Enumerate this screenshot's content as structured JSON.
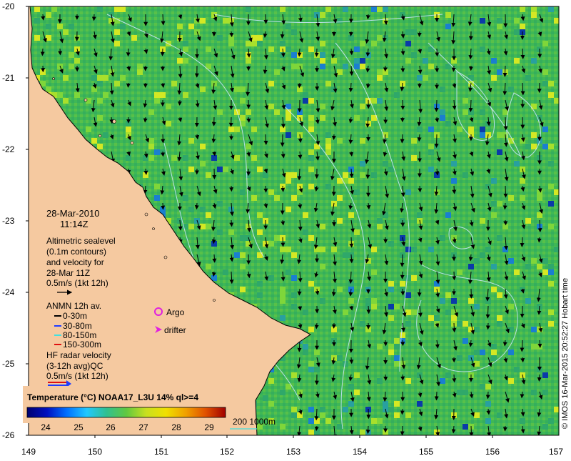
{
  "map": {
    "lat_labels": [
      "-20",
      "-21",
      "-22",
      "-23",
      "-24",
      "-25",
      "-26"
    ],
    "lon_labels": [
      "149",
      "150",
      "151",
      "152",
      "153",
      "154",
      "155",
      "156",
      "157"
    ],
    "colors": {
      "land": "#f5c9a0",
      "ocean_base": "#3fb855",
      "arrow": "#000000",
      "contour": "#cfe9ff",
      "frame": "#000000"
    }
  },
  "annotations": {
    "date": "28-Mar-2010",
    "time": "11:14Z",
    "altimetry": [
      "Altimetric sealevel",
      "(0.1m contours)",
      "and velocity for",
      "28-Mar 11Z",
      "0.5m/s (1kt 12h)"
    ],
    "anmn_title": "ANMN 12h av.",
    "anmn_depths": [
      {
        "label": "0-30m",
        "color": "#000000"
      },
      {
        "label": "30-80m",
        "color": "#1f3cff"
      },
      {
        "label": "80-150m",
        "color": "#40e0e0"
      },
      {
        "label": "150-300m",
        "color": "#e01010"
      }
    ],
    "argo_label": "Argo",
    "argo_color": "#e020e0",
    "drifter_label": "drifter",
    "drifter_color": "#e020e0",
    "hf_radar": [
      "HF radar velocity",
      "(3-12h avg)QC",
      "0.5m/s (1kt 12h)"
    ],
    "hf_colors": [
      "#e01010",
      "#1f3cff"
    ],
    "depth_contours": "200  1000m",
    "depth_contour_color": "#40e0e0",
    "credit": "© IMOS 16-Mar-2015 20:52:27 Hobart time"
  },
  "colorbar": {
    "title": "Temperature (°C) NOAA17_L3U 14% ql>=4",
    "ticks": [
      "24",
      "25",
      "26",
      "27",
      "28",
      "29"
    ],
    "stops": [
      "#000070",
      "#0010c0",
      "#0070ff",
      "#20c8ff",
      "#30c090",
      "#60c840",
      "#c8e020",
      "#f0e000",
      "#f0a000",
      "#e05000",
      "#a00000"
    ]
  }
}
